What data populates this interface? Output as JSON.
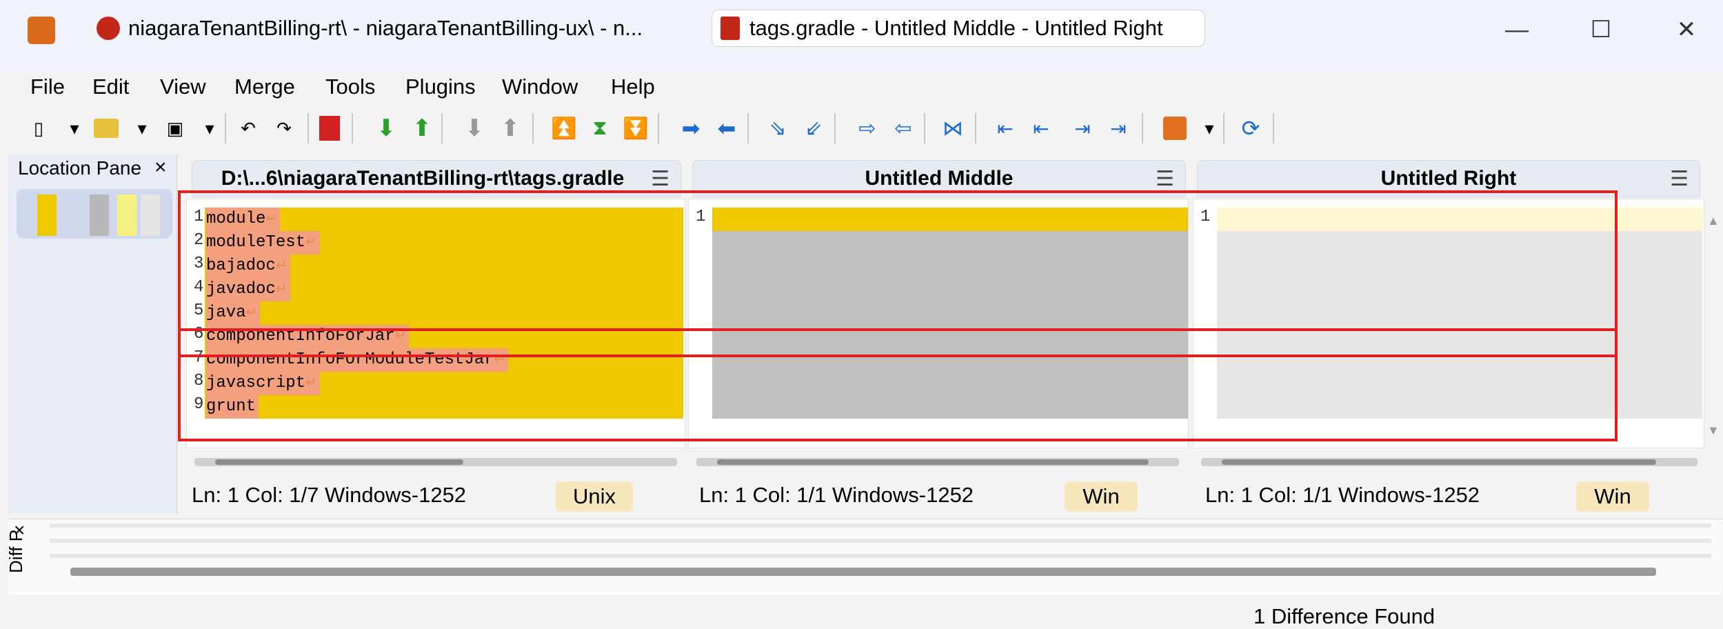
{
  "titlebar": {
    "tab1_title": "niagaraTenantBilling-rt\\ - niagaraTenantBilling-ux\\ - n...",
    "tab2_title": "tags.gradle - Untitled Middle - Untitled Right",
    "minimize": "—",
    "maximize": "☐",
    "close": "✕"
  },
  "menu": {
    "file": "File",
    "edit": "Edit",
    "view": "View",
    "merge": "Merge",
    "tools": "Tools",
    "plugins": "Plugins",
    "window": "Window",
    "help": "Help"
  },
  "location_pane": {
    "title": "Location Pane",
    "close": "×"
  },
  "panes": {
    "left": {
      "title": "D:\\...6\\niagaraTenantBilling-rt\\tags.gradle",
      "menu": "☰"
    },
    "middle": {
      "title": "Untitled Middle",
      "menu": "☰"
    },
    "right": {
      "title": "Untitled Right",
      "menu": "☰"
    }
  },
  "left_lines": [
    {
      "n": "1",
      "text": "module"
    },
    {
      "n": "2",
      "text": "moduleTest"
    },
    {
      "n": "3",
      "text": "bajadoc"
    },
    {
      "n": "4",
      "text": "javadoc"
    },
    {
      "n": "5",
      "text": "java"
    },
    {
      "n": "6",
      "text": "componentInfoForJar"
    },
    {
      "n": "7",
      "text": "componentInfoForModuleTestJar"
    },
    {
      "n": "8",
      "text": "javascript"
    },
    {
      "n": "9",
      "text": "grunt"
    }
  ],
  "middle_line_num": "1",
  "right_line_num": "1",
  "eol_glyph": "↵",
  "status": {
    "left": {
      "pos": "Ln: 1  Col: 1/7   Windows-1252",
      "eol": "Unix"
    },
    "middle": {
      "pos": "Ln: 1  Col: 1/1   Windows-1252",
      "eol": "Win"
    },
    "right": {
      "pos": "Ln: 1  Col: 1/1   Windows-1252",
      "eol": "Win"
    }
  },
  "diff_pane": {
    "title": "Diff P",
    "close": "×"
  },
  "footer": {
    "message": "1 Difference Found"
  },
  "colors": {
    "diff_yellow": "#f0c800",
    "diff_gray": "#c0c0c0",
    "text_highlight": "#f4a07e",
    "annotation_red": "#e02020"
  }
}
